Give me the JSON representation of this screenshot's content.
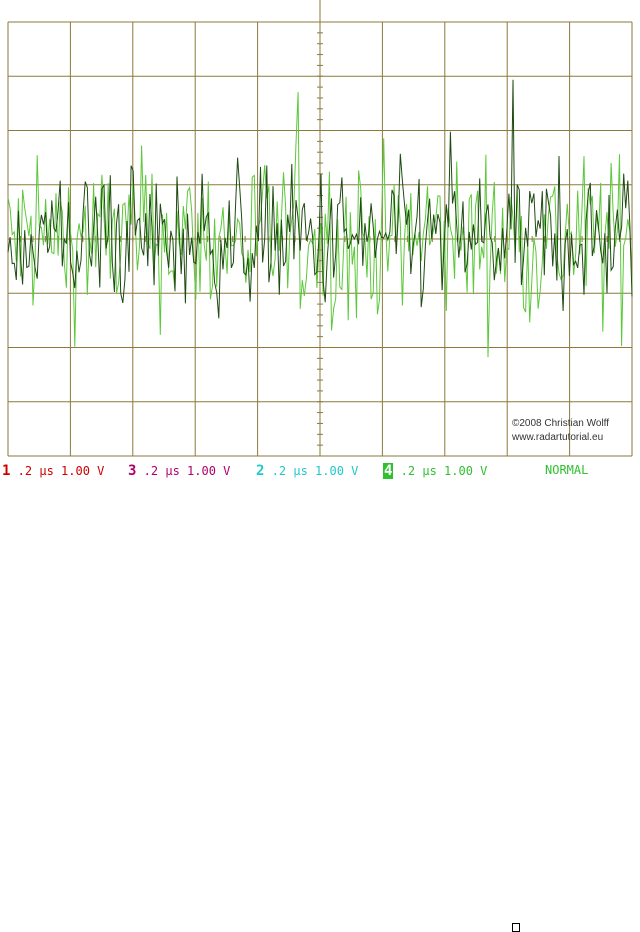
{
  "colors": {
    "background": "#ffffff",
    "grid": "#8b7a3c",
    "trace_dark": "#1f4a12",
    "trace_light": "#5cc83a",
    "ch1": "#cc0000",
    "ch3": "#b0006a",
    "ch2": "#22c8c8",
    "ch4": "#30c030",
    "mode": "#30c030"
  },
  "copyright": {
    "line1": "©2008 Christian Wolff",
    "line2": "www.radartutorial.eu"
  },
  "status": {
    "channels": [
      {
        "num": "1",
        "text": ".2 μs 1.00 V",
        "color": "#cc0000",
        "boxed": false
      },
      {
        "num": "3",
        "text": ".2 μs 1.00 V",
        "color": "#b0006a",
        "boxed": false
      },
      {
        "num": "2",
        "text": ".2 μs 1.00 V",
        "color": "#22c8c8",
        "boxed": false
      },
      {
        "num": "4",
        "text": ".2 μs 1.00 V",
        "color": "#30c030",
        "boxed": true
      }
    ],
    "mode": "NORMAL"
  },
  "chart_data": {
    "type": "line",
    "grid": {
      "divisions_x": 10,
      "divisions_y": 8,
      "visible": true
    },
    "x_per_div": ".2 μs",
    "y_per_div": "1.00 V",
    "series": [
      {
        "signal": "noise",
        "color": "#1f4a12",
        "samples": 300,
        "mean_div": 0.0,
        "amplitude_div": 2.2
      },
      {
        "signal": "noise",
        "color": "#5cc83a",
        "samples": 300,
        "mean_div": 0.0,
        "amplitude_div": 2.6
      }
    ]
  }
}
